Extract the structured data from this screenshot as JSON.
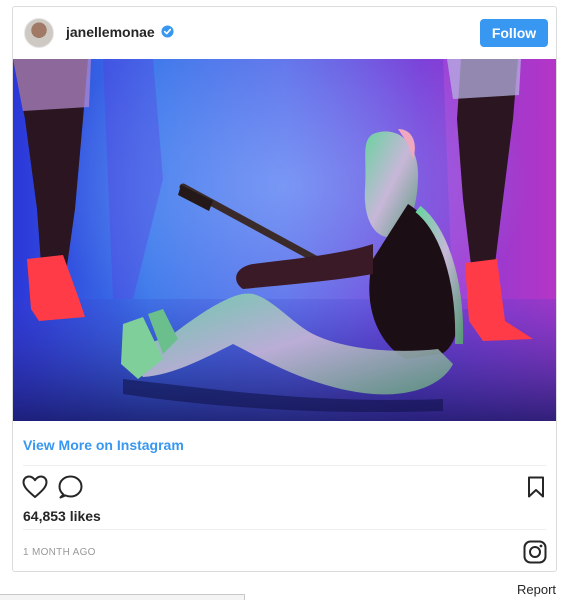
{
  "post": {
    "username": "janellemonae",
    "follow_label": "Follow",
    "view_more_label": "View More on Instagram",
    "likes": "64,853 likes",
    "timestamp": "1 MONTH AGO",
    "report_label": "Report"
  },
  "icons": {
    "verified": "verified-badge-icon",
    "like": "heart-icon",
    "comment": "comment-bubble-icon",
    "save": "bookmark-icon",
    "instagram": "instagram-logo-icon"
  },
  "colors": {
    "accent": "#3897f0",
    "text": "#262626",
    "muted": "#999999",
    "border": "#dbdbdb"
  }
}
